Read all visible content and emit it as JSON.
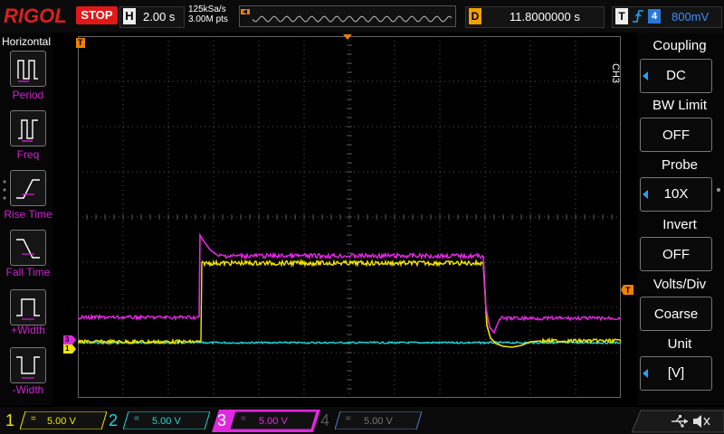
{
  "top": {
    "logo": "RIGOL",
    "run_status": "STOP",
    "h_letter": "H",
    "timebase": "2.00 s",
    "sample_rate": "125kSa/s",
    "mem_depth": "3.00M pts",
    "d_letter": "D",
    "delay": "11.8000000 s",
    "t_letter": "T",
    "trigger_source": "4",
    "trigger_level": "800mV"
  },
  "left": {
    "title": "Horizontal",
    "items": [
      {
        "label": "Period",
        "icon": "period-icon"
      },
      {
        "label": "Freq",
        "icon": "freq-icon"
      },
      {
        "label": "Rise Time",
        "icon": "rise-time-icon"
      },
      {
        "label": "Fall Time",
        "icon": "fall-time-icon"
      },
      {
        "label": "+Width",
        "icon": "positive-width-icon"
      },
      {
        "label": "-Width",
        "icon": "negative-width-icon"
      }
    ]
  },
  "right": {
    "channel": "CH3",
    "menu": [
      {
        "title": "Coupling",
        "value": "DC"
      },
      {
        "title": "BW Limit",
        "value": "OFF"
      },
      {
        "title": "Probe",
        "value": "10X"
      },
      {
        "title": "Invert",
        "value": "OFF"
      },
      {
        "title": "Volts/Div",
        "value": "Coarse"
      },
      {
        "title": "Unit",
        "value": "[V]"
      }
    ]
  },
  "markers": {
    "trigger_pos": "T",
    "ch3_marker": "3",
    "ch1_marker": "1",
    "trigger_level_marker": "T"
  },
  "bottom": {
    "channels": [
      {
        "num": "1",
        "volts": "5.00 V",
        "coupling": "=",
        "color": "#f2e600"
      },
      {
        "num": "2",
        "volts": "5.00 V",
        "coupling": "=",
        "color": "#21d6d6"
      },
      {
        "num": "3",
        "volts": "5.00 V",
        "coupling": "=",
        "color": "#e028e0"
      },
      {
        "num": "4",
        "volts": "5.00 V",
        "coupling": "=",
        "color": "#4c7fd0"
      }
    ]
  },
  "colors": {
    "ch1": "#f2e600",
    "ch2": "#21d6d6",
    "ch3": "#e028e0",
    "ch4": "#4c7fd0",
    "trigger": "#f08000"
  }
}
